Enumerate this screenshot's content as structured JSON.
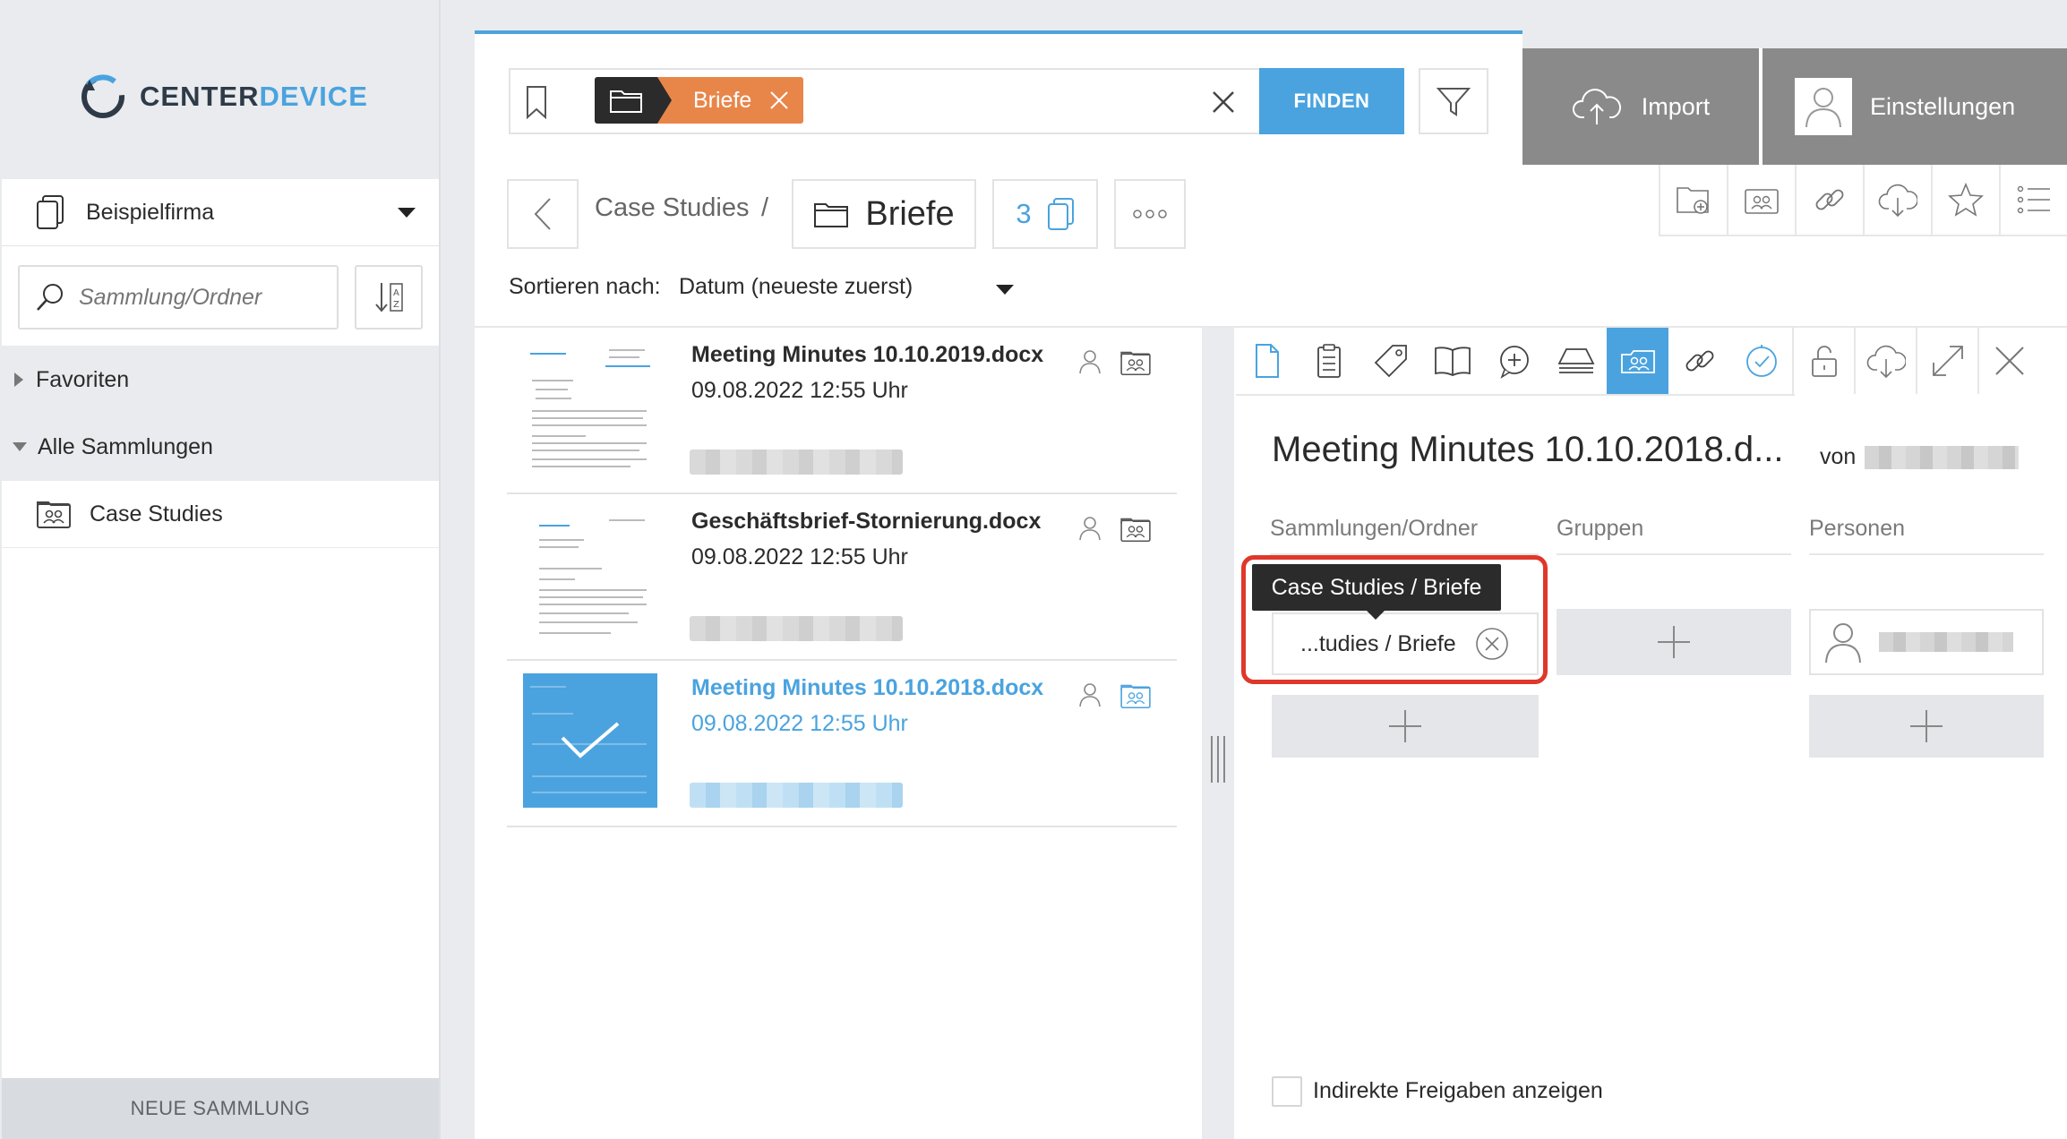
{
  "app": {
    "logo_a": "CENTER",
    "logo_b": "DEVICE",
    "brand_color": "#4aa3df",
    "accent_orange": "#e8864a",
    "highlight_color": "#e0372b"
  },
  "sidebar": {
    "company": "Beispielfirma",
    "search_placeholder": "Sammlung/Ordner",
    "favorites": "Favoriten",
    "all_collections": "Alle Sammlungen",
    "collection": "Case Studies",
    "new_collection": "NEUE SAMMLUNG"
  },
  "search": {
    "chip_label": "Briefe",
    "find_button": "FINDEN"
  },
  "header": {
    "import": "Import",
    "settings": "Einstellungen"
  },
  "breadcrumb": {
    "parent": "Case Studies",
    "separator": "/",
    "current": "Briefe",
    "count": "3"
  },
  "sort": {
    "label": "Sortieren nach:",
    "value": "Datum (neueste zuerst)"
  },
  "documents": [
    {
      "title": "Meeting Minutes 10.10.2019.docx",
      "date": "09.08.2022 12:55 Uhr",
      "selected": false
    },
    {
      "title": "Geschäftsbrief-Stornierung.docx",
      "date": "09.08.2022 12:55 Uhr",
      "selected": false
    },
    {
      "title": "Meeting Minutes 10.10.2018.docx",
      "date": "09.08.2022 12:55 Uhr",
      "selected": true
    }
  ],
  "detail": {
    "title": "Meeting Minutes 10.10.2018.d...",
    "by": "von",
    "col_collections": "Sammlungen/Ordner",
    "col_groups": "Gruppen",
    "col_persons": "Personen",
    "tooltip": "Case Studies / Briefe",
    "assigned": "...tudies / Briefe",
    "indirect_label": "Indirekte Freigaben anzeigen",
    "indirect_checked": false,
    "active_tab": "sharing"
  }
}
